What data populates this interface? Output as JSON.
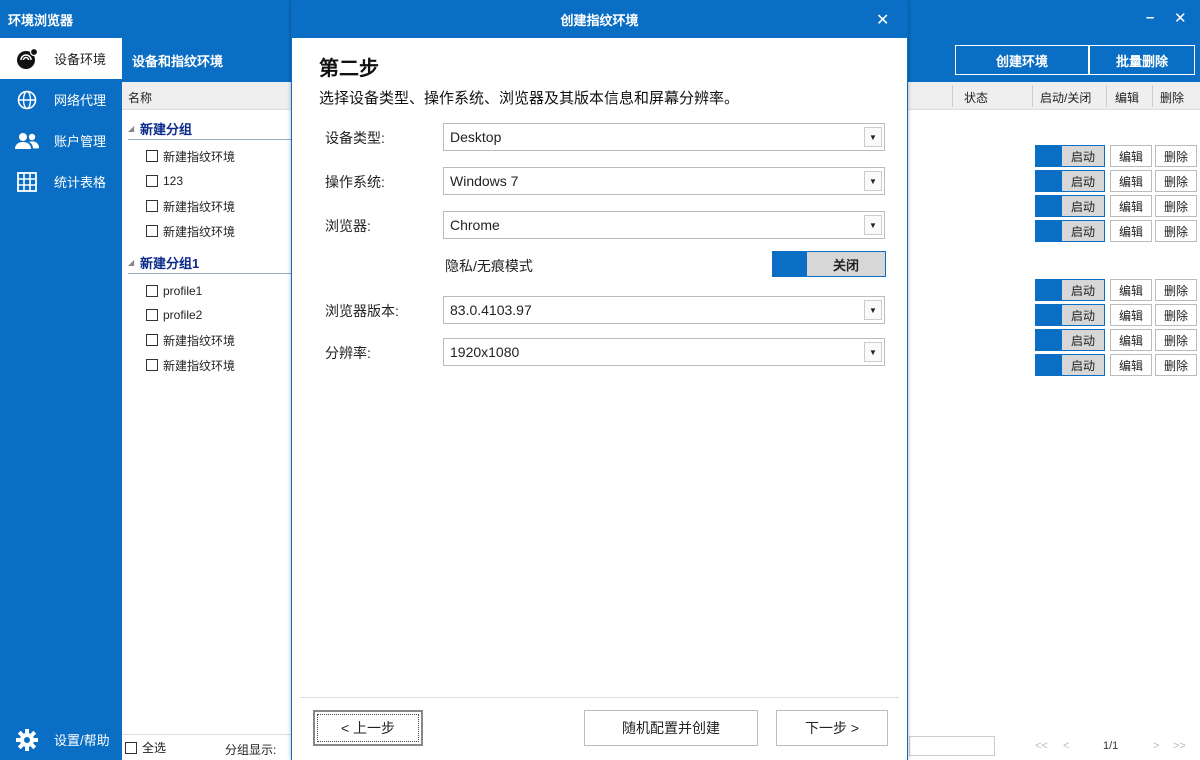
{
  "app": {
    "title": "环境浏览器",
    "minimize": "–",
    "close": "✕"
  },
  "nav": {
    "items": [
      {
        "label": "设备环境",
        "icon": "fingerprint-icon"
      },
      {
        "label": "网络代理",
        "icon": "globe-icon"
      },
      {
        "label": "账户管理",
        "icon": "users-icon"
      },
      {
        "label": "统计表格",
        "icon": "grid-icon"
      }
    ],
    "settings": {
      "label": "设置/帮助",
      "icon": "gear-icon"
    }
  },
  "tree": {
    "header": "设备和指纹环境",
    "column": "名称",
    "groups": [
      {
        "name": "新建分组",
        "items": [
          "新建指纹环境",
          "123",
          "新建指纹环境",
          "新建指纹环境"
        ]
      },
      {
        "name": "新建分组1",
        "items": [
          "profile1",
          "profile2",
          "新建指纹环境",
          "新建指纹环境"
        ]
      }
    ],
    "select_all": "全选",
    "group_display": "分组显示:"
  },
  "right": {
    "create_button": "创建环境",
    "batch_delete_button": "批量删除",
    "columns": {
      "status": "状态",
      "toggle": "启动/关闭",
      "edit": "编辑",
      "delete": "删除"
    },
    "row_toggle": "启动",
    "row_edit": "编辑",
    "row_delete": "删除",
    "pager": {
      "first": "<<",
      "prev": "<",
      "page": "1/1",
      "next": ">",
      "last": ">>"
    }
  },
  "modal": {
    "title": "创建指纹环境",
    "close": "✕",
    "step_title": "第二步",
    "step_desc": "选择设备类型、操作系统、浏览器及其版本信息和屏幕分辨率。",
    "fields": {
      "device_type": {
        "label": "设备类型:",
        "value": "Desktop"
      },
      "os": {
        "label": "操作系统:",
        "value": "Windows 7"
      },
      "browser": {
        "label": "浏览器:",
        "value": "Chrome"
      },
      "browser_version": {
        "label": "浏览器版本:",
        "value": "83.0.4103.97"
      },
      "resolution": {
        "label": "分辨率:",
        "value": "1920x1080"
      }
    },
    "privacy": {
      "label": "隐私/无痕模式",
      "toggle": "关闭"
    },
    "buttons": {
      "prev": "< 上一步",
      "random": "随机配置并创建",
      "next": "下一步 >"
    }
  },
  "colors": {
    "accent": "#0a6fc4",
    "group_text": "#0b2a8a",
    "toggle_off": "#d7d7d7"
  }
}
